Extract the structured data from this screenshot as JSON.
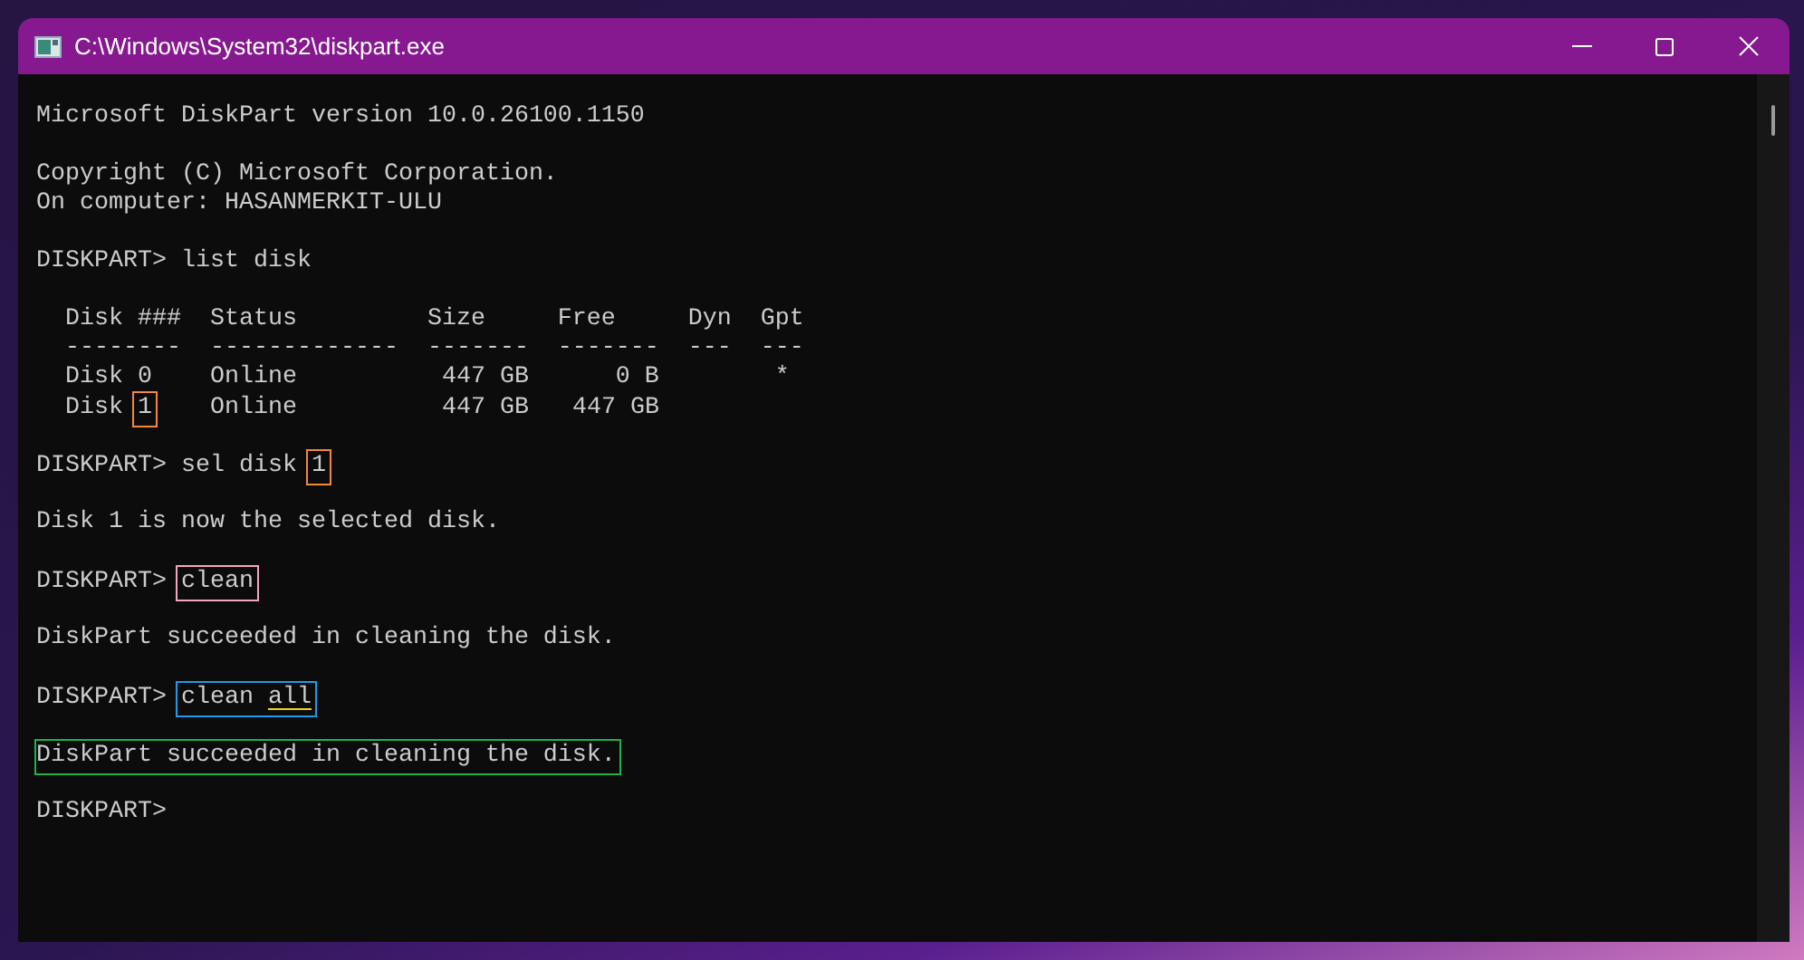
{
  "window": {
    "title": "C:\\Windows\\System32\\diskpart.exe"
  },
  "console": {
    "lines": [
      {
        "kind": "text",
        "segments": [
          {
            "text": "Microsoft DiskPart version 10.0.26100.1150"
          }
        ]
      },
      {
        "kind": "blank"
      },
      {
        "kind": "text",
        "segments": [
          {
            "text": "Copyright (C) Microsoft Corporation."
          }
        ]
      },
      {
        "kind": "text",
        "segments": [
          {
            "text": "On computer: HASANMERKIT-ULU"
          }
        ]
      },
      {
        "kind": "blank"
      },
      {
        "kind": "text",
        "segments": [
          {
            "text": "DISKPART> list disk"
          }
        ]
      },
      {
        "kind": "blank"
      },
      {
        "kind": "text",
        "segments": [
          {
            "text": "  Disk ###  Status         Size     Free     Dyn  Gpt"
          }
        ]
      },
      {
        "kind": "text",
        "segments": [
          {
            "text": "  --------  -------------  -------  -------  ---  ---"
          }
        ]
      },
      {
        "kind": "text",
        "segments": [
          {
            "text": "  Disk 0    Online          447 GB      0 B        *"
          }
        ]
      },
      {
        "kind": "text",
        "segments": [
          {
            "text": "  Disk "
          },
          {
            "text": "1",
            "color": "#f0883e"
          },
          {
            "text": "    Online          447 GB   447 GB"
          }
        ]
      },
      {
        "kind": "blank"
      },
      {
        "kind": "text",
        "segments": [
          {
            "text": "DISKPART> sel disk "
          },
          {
            "text": "1",
            "color": "#f0883e"
          }
        ]
      },
      {
        "kind": "blank"
      },
      {
        "kind": "text",
        "segments": [
          {
            "text": "Disk 1 is now the selected disk."
          }
        ]
      },
      {
        "kind": "blank"
      },
      {
        "kind": "text",
        "segments": [
          {
            "text": "DISKPART> "
          },
          {
            "text": "clean",
            "color": "#f4a6c0"
          }
        ]
      },
      {
        "kind": "blank"
      },
      {
        "kind": "text",
        "segments": [
          {
            "text": "DiskPart succeeded in cleaning the disk."
          }
        ]
      },
      {
        "kind": "blank"
      },
      {
        "kind": "text",
        "segments": [
          {
            "text": "DISKPART> "
          },
          {
            "color": "#1e9bea",
            "parts": [
              {
                "text": "clean ",
                "underlined": false
              },
              {
                "text": "all",
                "underlined": true
              }
            ]
          }
        ]
      },
      {
        "kind": "blank"
      },
      {
        "kind": "text",
        "segments": [
          {
            "text": "DiskPart succeeded in cleaning the disk.",
            "color": "#22b14c"
          }
        ]
      },
      {
        "kind": "blank"
      },
      {
        "kind": "text",
        "segments": [
          {
            "text": "DISKPART>"
          }
        ]
      }
    ]
  }
}
